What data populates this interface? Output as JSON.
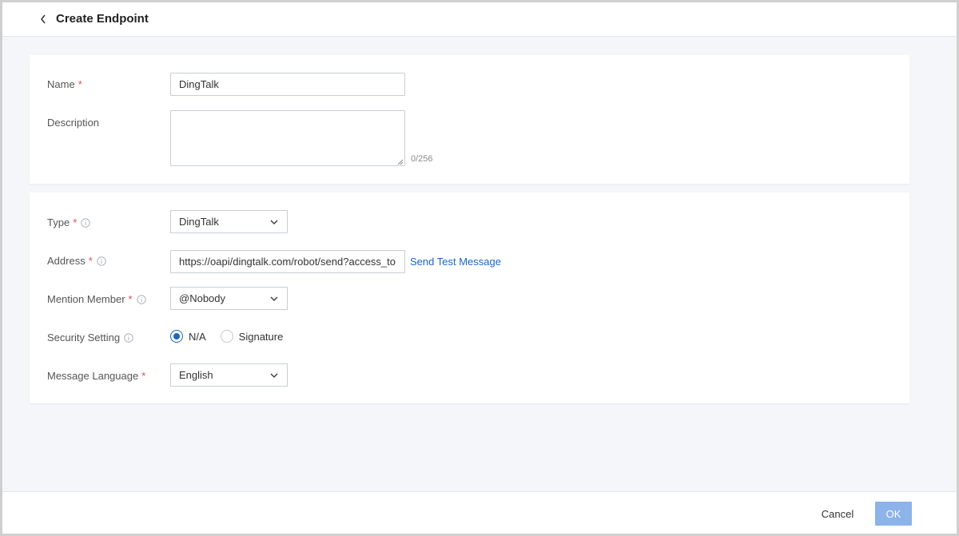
{
  "header": {
    "title": "Create Endpoint"
  },
  "basic": {
    "name_label": "Name",
    "name_value": "DingTalk",
    "description_label": "Description",
    "description_value": "",
    "description_counter": "0/256"
  },
  "config": {
    "type_label": "Type",
    "type_value": "DingTalk",
    "address_label": "Address",
    "address_value": "https://oapi/dingtalk.com/robot/send?access_to",
    "send_test_label": "Send Test Message",
    "mention_label": "Mention Member",
    "mention_value": "@Nobody",
    "security_label": "Security Setting",
    "security_options": [
      {
        "label": "N/A",
        "checked": true
      },
      {
        "label": "Signature",
        "checked": false
      }
    ],
    "language_label": "Message Language",
    "language_value": "English"
  },
  "footer": {
    "cancel_label": "Cancel",
    "ok_label": "OK"
  },
  "colors": {
    "accent": "#1a66c7",
    "required": "#e5484d",
    "ok_button": "#8cb3ea",
    "background": "#f4f6f9"
  },
  "icons": {
    "back": "chevron-left-icon",
    "info": "info-circle-icon",
    "dropdown": "chevron-down-icon"
  }
}
